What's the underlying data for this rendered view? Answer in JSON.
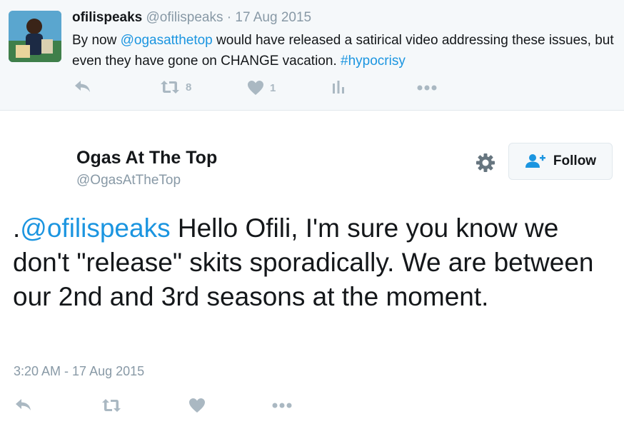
{
  "reply_tweet": {
    "author_name": "ofilispeaks",
    "author_handle": "@ofilispeaks",
    "separator": " · ",
    "date": "17 Aug 2015",
    "text_before": "By now ",
    "mention": "@ogasatthetop",
    "text_middle": " would have released a satirical video addressing these issues, but even they have gone on CHANGE vacation. ",
    "hashtag": "#hypocrisy",
    "retweet_count": "8",
    "like_count": "1"
  },
  "main_tweet": {
    "author_name": "Ogas At The Top",
    "author_handle": "@OgasAtTheTop",
    "follow_label": "Follow",
    "text_prefix": ".",
    "mention": "@ofilispeaks",
    "text_body": " Hello Ofili, I'm sure you know we don't \"release\" skits sporadically. We are between our 2nd and 3rd seasons at the moment.",
    "timestamp": "3:20 AM - 17 Aug 2015"
  },
  "icons": {
    "reply": "reply-icon",
    "retweet": "retweet-icon",
    "like": "heart-icon",
    "analytics": "analytics-icon",
    "more": "more-icon",
    "settings": "gear-icon",
    "follow": "add-user-icon"
  },
  "colors": {
    "link": "#1b95e0",
    "muted": "#8899a6",
    "icon": "#aab8c2",
    "reply_background": "#f5f8fa"
  }
}
